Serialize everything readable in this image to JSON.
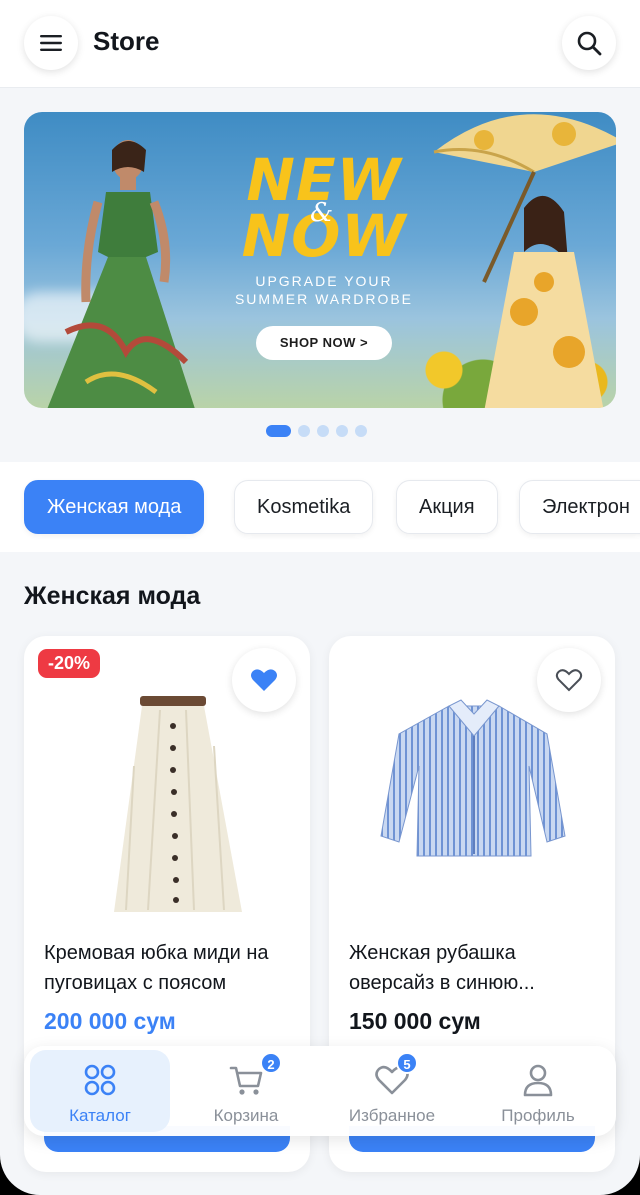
{
  "header": {
    "title": "Store"
  },
  "banner": {
    "headline_top": "NEW",
    "headline_amp": "&",
    "headline_bottom": "NOW",
    "subline_1": "UPGRADE YOUR",
    "subline_2": "SUMMER WARDROBE",
    "cta": "SHOP NOW >",
    "slides_count": 5,
    "active_slide": 1
  },
  "categories": [
    {
      "label": "Женская мода",
      "active": true
    },
    {
      "label": "Kosmetika",
      "active": false
    },
    {
      "label": "Акция",
      "active": false
    },
    {
      "label": "Электрон",
      "active": false
    }
  ],
  "section": {
    "title": "Женская мода"
  },
  "products": [
    {
      "badge": "-20%",
      "name": "Кремовая юбка миди на пуговицах с поясом",
      "price": "200 000 сум",
      "favorited": true
    },
    {
      "badge": "",
      "name": "Женская рубашка оверсайз в синюю...",
      "price": "150 000 сум",
      "favorited": false
    }
  ],
  "bottom_nav": [
    {
      "label": "Каталог",
      "icon": "grid-icon",
      "active": true
    },
    {
      "label": "Корзина",
      "icon": "cart-icon",
      "badge": "2"
    },
    {
      "label": "Избранное",
      "icon": "heart-icon",
      "badge": "5"
    },
    {
      "label": "Профиль",
      "icon": "user-icon"
    }
  ],
  "colors": {
    "accent": "#3b82f6",
    "sale": "#ee3a43",
    "banner_yellow": "#f8c31b"
  }
}
